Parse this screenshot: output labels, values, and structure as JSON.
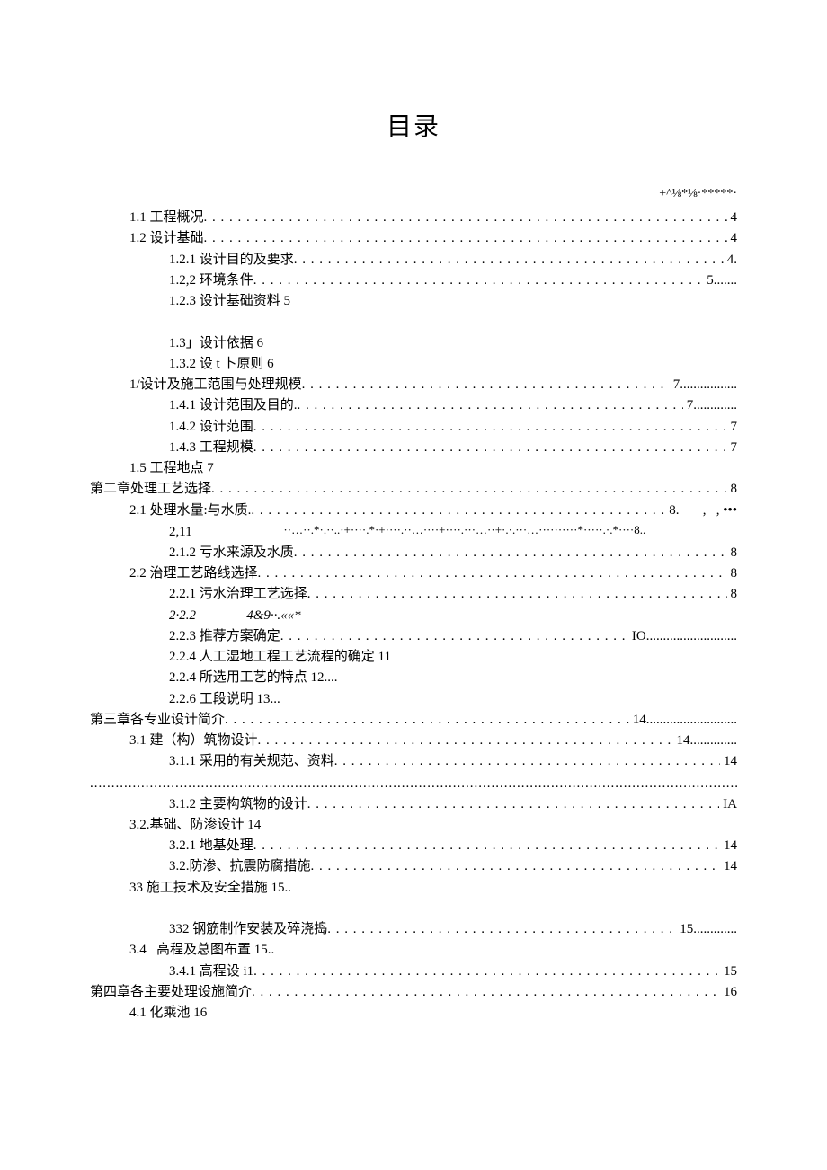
{
  "title": "目录",
  "garble_top": "+^⅛*⅛·*****·",
  "lines": [
    {
      "cls": "ind1",
      "label": "1.1 工程概况",
      "num": "4",
      "dots": true
    },
    {
      "cls": "ind1",
      "label": "1.2 设计基础",
      "num": "4",
      "dots": true
    },
    {
      "cls": "ind2",
      "label": "1.2.1 设计目的及要求",
      "num": "4.",
      "dots": true
    },
    {
      "cls": "ind2",
      "label": "1.2,2 环境条件",
      "num": "5",
      "dots": true,
      "trail": "......."
    },
    {
      "cls": "ind2",
      "label": "1.2.3 设计基础资料 5",
      "dots": false
    },
    {
      "cls": "",
      "label": " ",
      "dots": false
    },
    {
      "cls": "ind2",
      "label": "1.3」设计依据 6",
      "dots": false
    },
    {
      "cls": "ind2",
      "label": "1.3.2 设 t 卜原则 6",
      "dots": false
    },
    {
      "cls": "ind1",
      "label": "1/设计及施工范围与处理规模 ",
      "num": "7",
      "dots": true,
      "trail": "................."
    },
    {
      "cls": "ind2",
      "label": "1.4.1 设计范围及目的.",
      "num": "7",
      "dots": true,
      "trail": "............."
    },
    {
      "cls": "ind2",
      "label": "1.4.2 设计范围 ",
      "num": "7",
      "dots": true
    },
    {
      "cls": "ind2",
      "label": "1.4.3 工程规模",
      "num": "7",
      "dots": true
    },
    {
      "cls": "ind1",
      "label": "1.5 工程地点 7",
      "dots": false
    },
    {
      "cls": "ind0",
      "label": "第二章处理工艺选择 ",
      "num": "8",
      "dots": true
    },
    {
      "cls": "ind1",
      "label": "2.1 处理水量:与水质. ",
      "num": "8.",
      "dots": true,
      "trail": "       ,   , •••"
    },
    {
      "garble": true,
      "left": "2,11",
      "mid": "··…··.*·.··..·+····.*·+····.··…····+····.···…··+·.·.···…··········*·····.·.*····8.."
    },
    {
      "cls": "ind2",
      "label": "2.1.2 亏水来源及水质 ",
      "num": "8",
      "dots": true
    },
    {
      "cls": "ind1",
      "label": "2.2 治理工艺路线选择 ",
      "num": "8",
      "dots": true
    },
    {
      "cls": "ind2",
      "label": "2.2.1 污水治理工艺选择 ",
      "num": "8",
      "dots": true
    },
    {
      "cls": "ind2",
      "label": "2·2.2               4&9··.««*",
      "dots": false,
      "italic": true
    },
    {
      "cls": "ind2",
      "label": "2.2.3 推荐方案确定 ",
      "num": "IO",
      "dots": true,
      "trail": " ..........................."
    },
    {
      "cls": "ind2",
      "label": "2.2.4 人工湿地工程工艺流程的确定 11",
      "dots": false
    },
    {
      "cls": "ind2",
      "label": "2.2.4 所选用工艺的特点 12....",
      "dots": false
    },
    {
      "cls": "ind2",
      "label": "2.2.6 工段说明 13...",
      "dots": false
    },
    {
      "cls": "ind0",
      "label": "第三章各专业设计简介 ",
      "num": "14",
      "dots": true,
      "trail": "..........................."
    },
    {
      "cls": "ind1",
      "label": "3.1 建（构）筑物设计 ",
      "num": "14",
      "dots": true,
      "trail": ".............."
    },
    {
      "cls": "ind2",
      "label": "3.1.1 采用的有关规范、资料 ",
      "num": "14",
      "dots": true
    },
    {
      "dots_only": true
    },
    {
      "cls": "ind2",
      "label": "3.1.2 主要构筑物的设计",
      "num": "IA",
      "dots": true
    },
    {
      "cls": "ind1",
      "label": "3.2.基础、防渗设计 14",
      "dots": false
    },
    {
      "cls": "ind2",
      "label": "3.2.1 地基处理 ",
      "num": "14",
      "dots": true
    },
    {
      "cls": "ind2",
      "label": "3.2.防渗、抗震防腐措施 ",
      "num": "14",
      "dots": true
    },
    {
      "cls": "ind1",
      "label": "33 施工技术及安全措施 15..",
      "dots": false
    },
    {
      "cls": "",
      "label": " ",
      "dots": false
    },
    {
      "cls": "ind2",
      "label": "332 钢筋制作安装及碎浇捣",
      "num": "15",
      "dots": true,
      "trail": "............."
    },
    {
      "cls": "ind1",
      "label": "3.4   高程及总图布置 15..",
      "dots": false
    },
    {
      "cls": "ind2",
      "label": "3.4.1 高程设 i1",
      "num": "15",
      "dots": true
    },
    {
      "cls": "ind0",
      "label": "第四章各主要处理设施简介 ",
      "num": "16",
      "dots": true
    },
    {
      "cls": "ind1",
      "label": "4.1 化乘池 16",
      "dots": false
    }
  ]
}
